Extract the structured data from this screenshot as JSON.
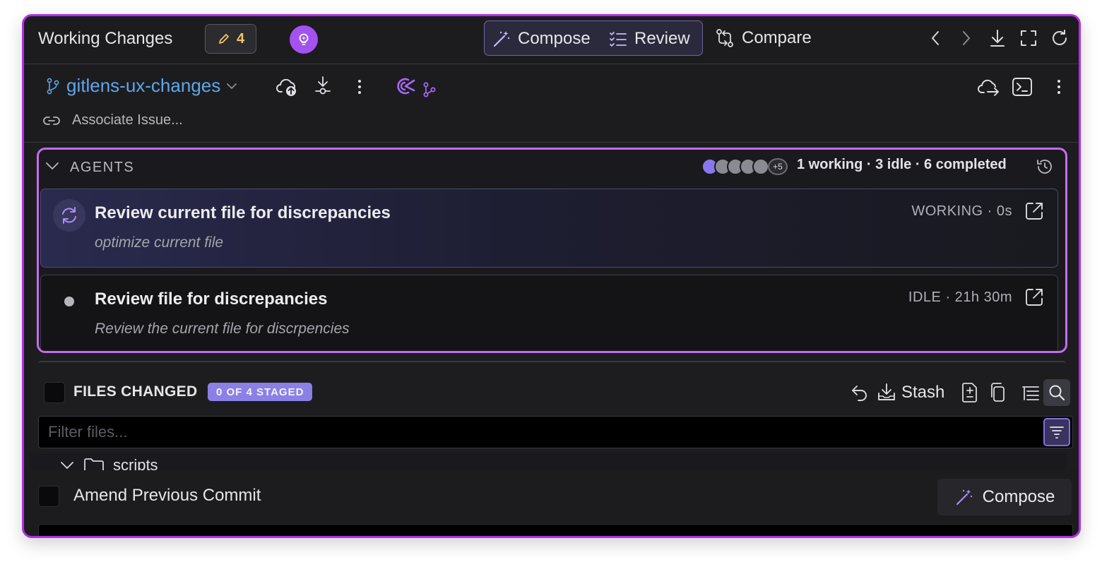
{
  "colors": {
    "accent": "#b02ee6",
    "agents_border": "#c46cf0",
    "branch": "#5fa6e8",
    "badge": "#8b80e6",
    "count": "#f0c56b"
  },
  "header": {
    "title": "Working Changes",
    "changes_count": "4",
    "modes": {
      "compose": "Compose",
      "review": "Review",
      "compare": "Compare"
    }
  },
  "branchbar": {
    "branch_name": "gitlens-ux-changes",
    "associate_issue": "Associate Issue..."
  },
  "agents": {
    "title": "AGENTS",
    "more_count": "+5",
    "summary": "1 working · 3 idle · 6 completed",
    "items": [
      {
        "title": "Review current file for discrepancies",
        "subtitle": "optimize current file",
        "status": "WORKING · 0s"
      },
      {
        "title": "Review file for discrepancies",
        "subtitle": "Review the current file for discrpencies",
        "status": "IDLE · 21h 30m"
      }
    ]
  },
  "files": {
    "title": "FILES CHANGED",
    "staged": "0 OF 4 STAGED",
    "stash_label": "Stash",
    "filter_placeholder": "Filter files...",
    "tree": [
      {
        "name": "scripts"
      }
    ]
  },
  "footer": {
    "amend_label": "Amend Previous Commit",
    "compose_label": "Compose"
  }
}
